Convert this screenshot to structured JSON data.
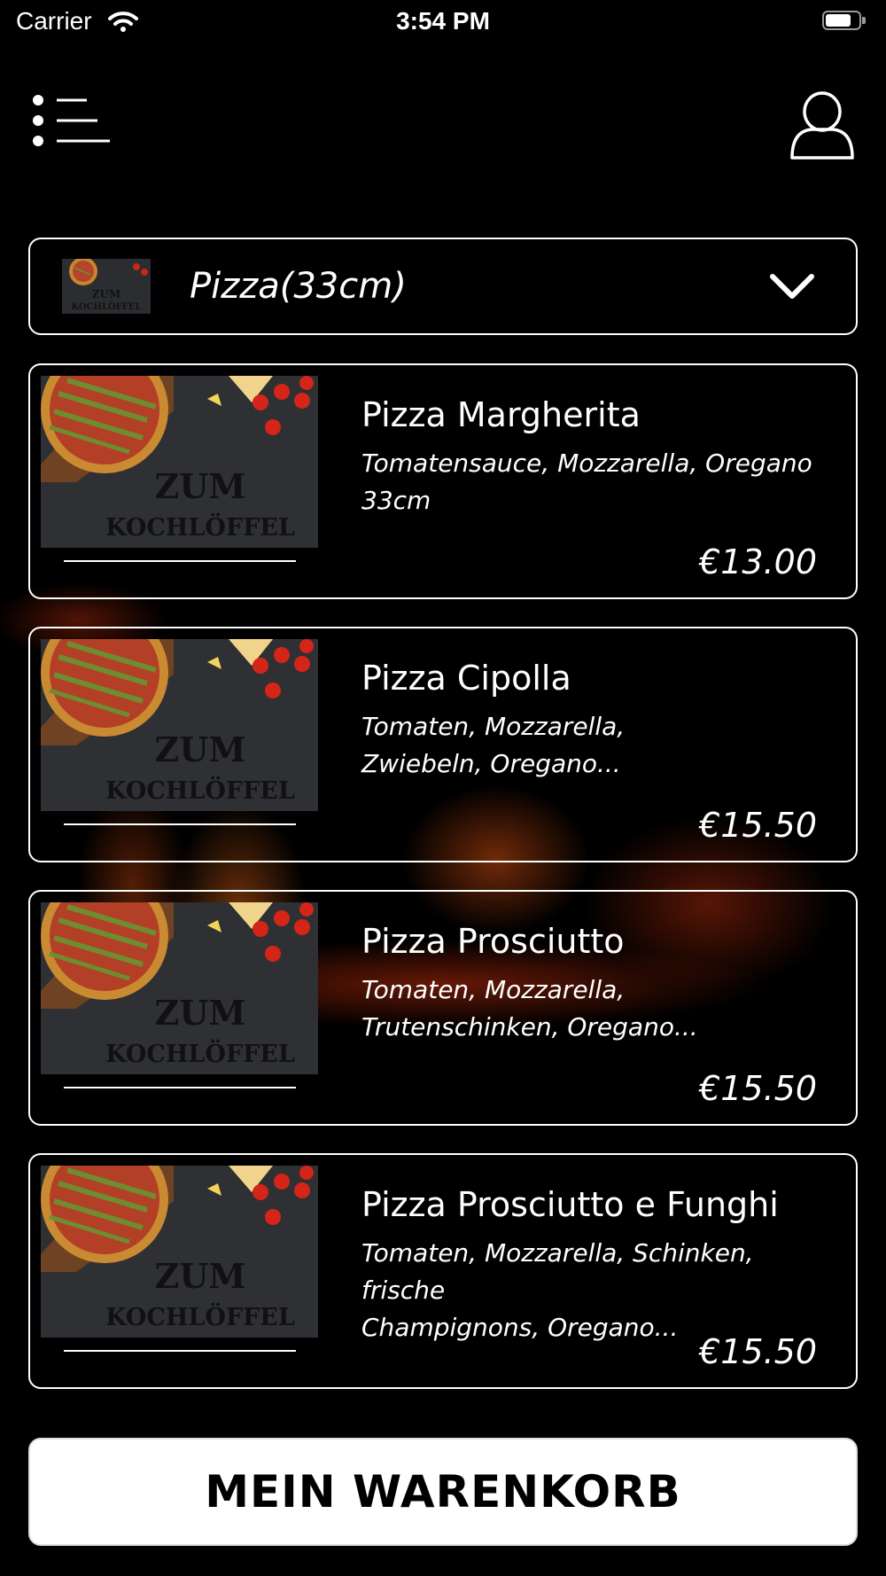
{
  "status_bar": {
    "carrier": "Carrier",
    "time": "3:54 PM"
  },
  "header": {
    "menu_icon": "menu-list-icon",
    "user_icon": "user-profile-icon"
  },
  "category": {
    "label": "Pizza(33cm)",
    "thumb_text_line1": "ZUM",
    "thumb_text_line2": "KOCHLÖFFEL",
    "chevron_icon": "chevron-down-icon"
  },
  "image_brand": {
    "line1": "ZUM",
    "line2": "KOCHLÖFFEL"
  },
  "items": [
    {
      "name": "Pizza Margherita",
      "desc_line1": "Tomatensauce, Mozzarella, Oregano",
      "desc_line2": "33cm",
      "price": "€13.00"
    },
    {
      "name": "Pizza Cipolla",
      "desc_line1": "Tomaten, Mozzarella,",
      "desc_line2": "Zwiebeln, Oregano...",
      "price": "€15.50"
    },
    {
      "name": "Pizza Prosciutto",
      "desc_line1": "Tomaten, Mozzarella,",
      "desc_line2": "Trutenschinken, Oregano...",
      "price": "€15.50"
    },
    {
      "name": "Pizza Prosciutto e Funghi",
      "desc_line1": "Tomaten, Mozzarella, Schinken, frische",
      "desc_line2": "Champignons, Oregano...",
      "price": "€15.50"
    }
  ],
  "cart_button": {
    "label": "MEIN WARENKORB"
  },
  "colors": {
    "background": "#000000",
    "foreground": "#ffffff",
    "fire_accent": "#b4320a"
  }
}
